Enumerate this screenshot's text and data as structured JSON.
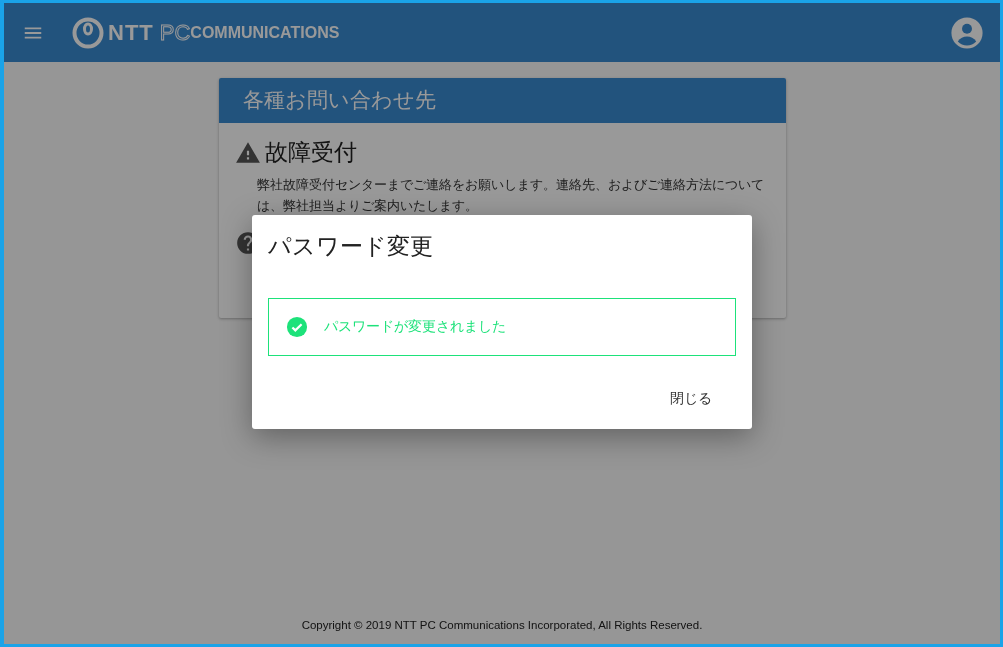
{
  "header": {
    "logo": [
      "NTT",
      "PC",
      "COMMUNICATIONS"
    ]
  },
  "card": {
    "title": "各種お問い合わせ先",
    "sections": [
      {
        "kind": "warning",
        "heading": "故障受付",
        "body": "弊社故障受付センターまでご連絡をお願いします。連絡先、およびご連絡方法については、弊社担当よりご案内いたします。"
      },
      {
        "kind": "question"
      }
    ]
  },
  "dialog": {
    "title": "パスワード変更",
    "message": {
      "kind": "success",
      "text": "パスワードが変更されました"
    },
    "buttons": [
      "閉じる"
    ]
  },
  "footer": "Copyright © 2019 NTT PC Communications Incorporated, All Rights Reserved."
}
